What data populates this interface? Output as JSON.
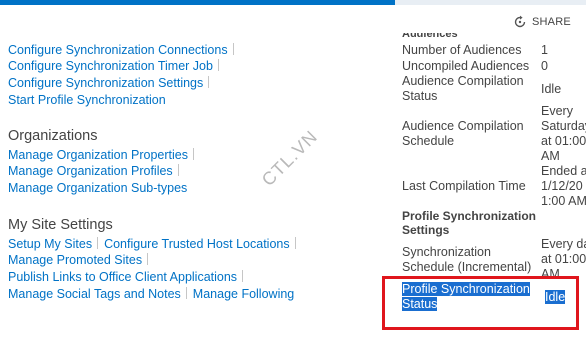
{
  "header": {
    "share_label": "SHARE",
    "share_icon": "share-icon"
  },
  "sync": {
    "items": [
      "Configure Synchronization Connections",
      "Configure Synchronization Timer Job",
      "Configure Synchronization Settings",
      "Start Profile Synchronization"
    ]
  },
  "organizations": {
    "title": "Organizations",
    "items": [
      "Manage Organization Properties",
      "Manage Organization Profiles",
      "Manage Organization Sub-types"
    ]
  },
  "mysite": {
    "title": "My Site Settings",
    "items": [
      "Setup My Sites",
      "Configure Trusted Host Locations",
      "Manage Promoted Sites",
      "Publish Links to Office Client Applications",
      "Manage Social Tags and Notes",
      "Manage Following"
    ]
  },
  "status": {
    "audiences_heading": "Audiences",
    "number_of_audiences_label": "Number of Audiences",
    "number_of_audiences_value": "1",
    "uncompiled_label": "Uncompiled Audiences",
    "uncompiled_value": "0",
    "compilation_status_label_1": "Audience Compilation",
    "compilation_status_label_2": "Status",
    "compilation_status_value": "Idle",
    "compilation_schedule_label_1": "Audience Compilation",
    "compilation_schedule_label_2": "Schedule",
    "compilation_schedule_value": [
      "Every",
      "Saturday",
      "at 01:00",
      "AM"
    ],
    "last_compilation_label": "Last Compilation Time",
    "last_compilation_value": [
      "Ended a",
      "1/12/20",
      "1:00 AM"
    ],
    "profile_sync_heading_1": "Profile Synchronization",
    "profile_sync_heading_2": "Settings",
    "sync_schedule_label": [
      "Synchronization",
      "Schedule (Incremental)"
    ],
    "sync_schedule_value": [
      "Every da",
      "at 01:00",
      "AM"
    ],
    "profile_sync_status_label": [
      "Profile Synchronization",
      "Status"
    ],
    "profile_sync_status_value": "Idle"
  },
  "watermark": "CTL.VN",
  "colors": {
    "accent": "#0072c6",
    "highlight": "#1a6ed0",
    "annotation": "#e0161c"
  }
}
